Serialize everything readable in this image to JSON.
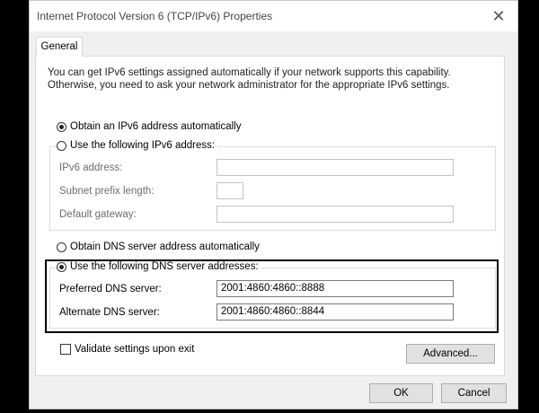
{
  "window": {
    "title": "Internet Protocol Version 6 (TCP/IPv6) Properties",
    "close_glyph": "✕"
  },
  "tabs": [
    {
      "label": "General",
      "selected": true
    }
  ],
  "description": {
    "line1": "You can get IPv6 settings assigned automatically if your network supports this capability.",
    "line2": "Otherwise, you need to ask your network administrator for the appropriate IPv6 settings."
  },
  "address": {
    "auto_label": "Obtain an IPv6 address automatically",
    "auto_selected": true,
    "manual_label": "Use the following IPv6 address:",
    "manual_selected": false,
    "fields": {
      "ipv6_label": "IPv6 address:",
      "ipv6_value": "",
      "prefix_label": "Subnet prefix length:",
      "prefix_value": "",
      "gateway_label": "Default gateway:",
      "gateway_value": ""
    }
  },
  "dns": {
    "auto_label": "Obtain DNS server address automatically",
    "auto_selected": false,
    "manual_label": "Use the following DNS server addresses:",
    "manual_selected": true,
    "preferred_label": "Preferred DNS server:",
    "preferred_value": "2001:4860:4860::8888",
    "alternate_label": "Alternate DNS server:",
    "alternate_value": "2001:4860:4860::8844"
  },
  "validate": {
    "label": "Validate settings upon exit",
    "checked": false
  },
  "buttons": {
    "advanced": "Advanced...",
    "ok": "OK",
    "cancel": "Cancel"
  }
}
